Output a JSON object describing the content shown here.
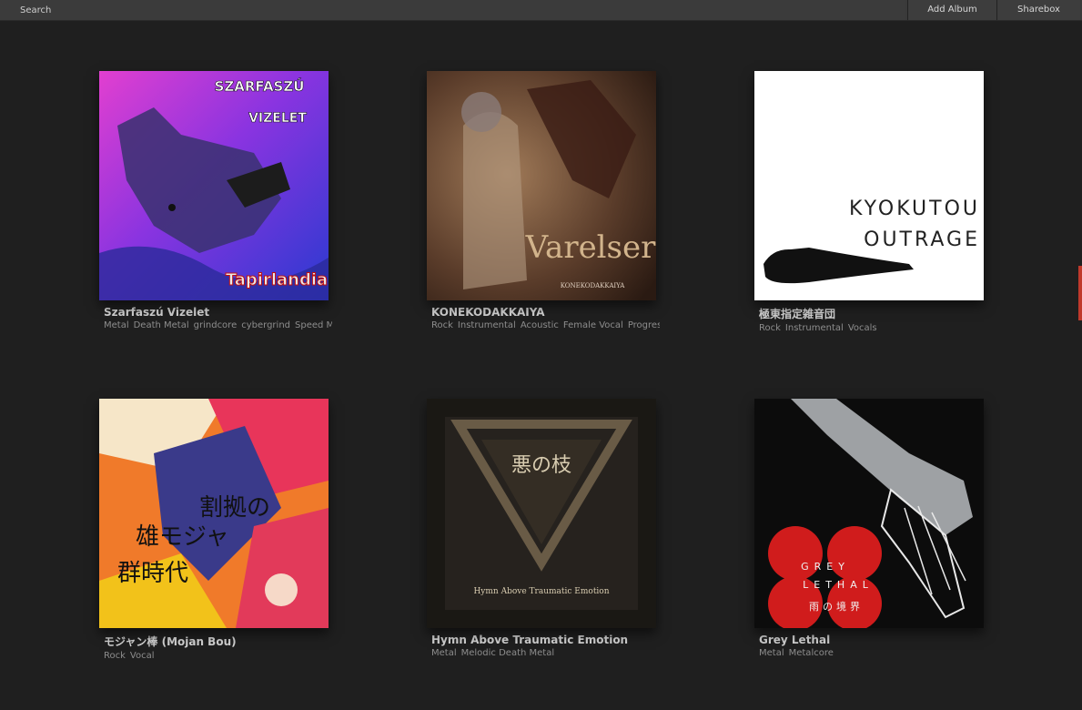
{
  "search": {
    "placeholder": "Search"
  },
  "toolbar": {
    "add_album_label": "Add Album",
    "sharebox_label": "Sharebox"
  },
  "albums": [
    {
      "title": "Szarfaszú Vizelet",
      "tags": [
        "Metal",
        "Death Metal",
        "grindcore",
        "cybergrind",
        "Speed Metal"
      ],
      "cover_text": [
        "SZARFASZÚ",
        "VIZELET",
        "Tapirlandia"
      ]
    },
    {
      "title": "KONEKODAKKAIYA",
      "tags": [
        "Rock",
        "Instrumental",
        "Acoustic",
        "Female Vocal",
        "Progressive"
      ],
      "cover_text": [
        "Varelser",
        "KONEKODAKKAIYA"
      ]
    },
    {
      "title": "極東指定雑音団",
      "tags": [
        "Rock",
        "Instrumental",
        "Vocals"
      ],
      "cover_text": [
        "KYOKUTOU",
        "OUTRAGE"
      ]
    },
    {
      "title": "モジャン棒 (Mojan Bou)",
      "tags": [
        "Rock",
        "Vocal"
      ],
      "cover_text": [
        "割拠の",
        "雄モジャ",
        "群時代"
      ]
    },
    {
      "title": "Hymn Above Traumatic Emotion",
      "tags": [
        "Metal",
        "Melodic Death Metal"
      ],
      "cover_text": [
        "悪の枝",
        "Hymn Above Traumatic Emotion"
      ]
    },
    {
      "title": "Grey Lethal",
      "tags": [
        "Metal",
        "Metalcore"
      ],
      "cover_text": [
        "GREY",
        "LETHAL",
        "雨の境界"
      ]
    }
  ]
}
